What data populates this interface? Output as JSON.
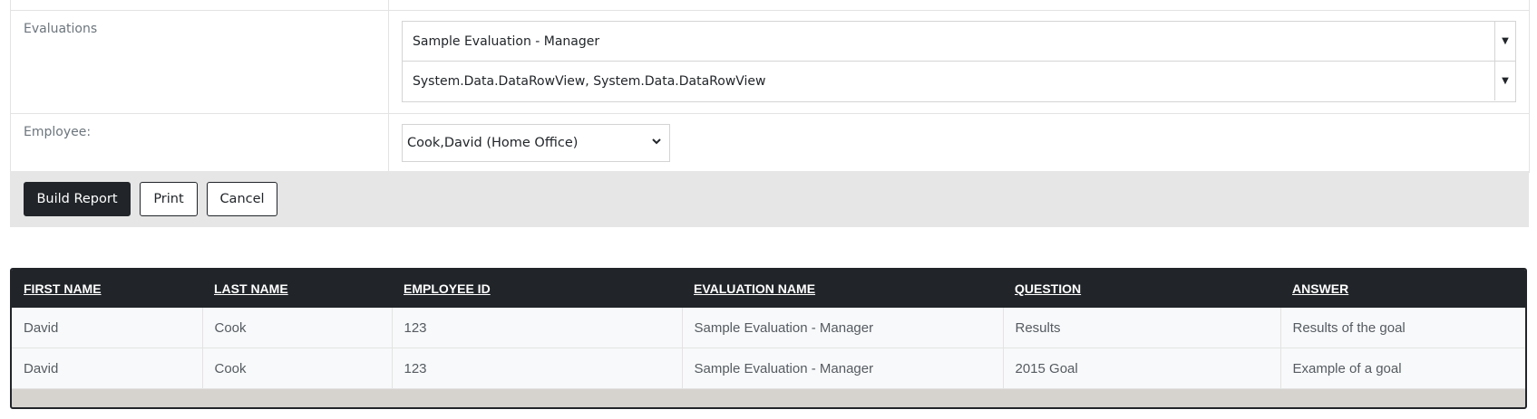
{
  "form": {
    "evaluations_label": "Evaluations",
    "evaluations_options": [
      "Sample Evaluation - Manager",
      "System.Data.DataRowView, System.Data.DataRowView"
    ],
    "employee_label": "Employee:",
    "employee_selected": "Cook,David (Home Office)"
  },
  "buttons": {
    "build_report": "Build Report",
    "print": "Print",
    "cancel": "Cancel"
  },
  "table": {
    "headers": [
      "FIRST NAME",
      "LAST NAME",
      "EMPLOYEE ID",
      "EVALUATION NAME",
      "QUESTION",
      "ANSWER"
    ],
    "rows": [
      [
        "David",
        "Cook",
        "123",
        "Sample Evaluation - Manager",
        "Results",
        "Results of the goal"
      ],
      [
        "David",
        "Cook",
        "123",
        "Sample Evaluation - Manager",
        "2015 Goal",
        "Example of a goal"
      ]
    ]
  }
}
